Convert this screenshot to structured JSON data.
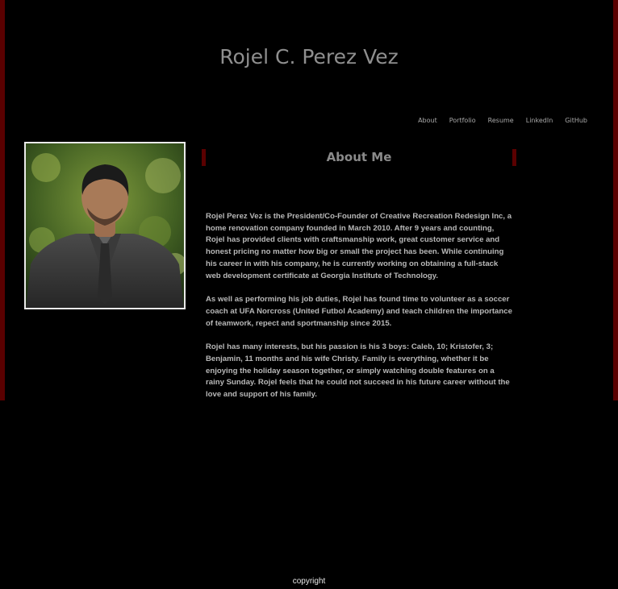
{
  "header": {
    "title": "Rojel C. Perez Vez"
  },
  "nav": {
    "items": [
      {
        "label": "About"
      },
      {
        "label": "Portfolio"
      },
      {
        "label": "Resume"
      },
      {
        "label": "LinkedIn"
      },
      {
        "label": "GitHub"
      }
    ]
  },
  "about": {
    "heading": "About Me",
    "paragraphs": [
      "Rojel Perez Vez is the President/Co-Founder of Creative Recreation Redesign Inc, a home renovation company founded in March 2010. After 9 years and counting, Rojel has provided clients with craftsmanship work, great customer service and honest pricing no matter how big or small the project has been. While continuing his career in with his company, he is currently working on obtaining a full-stack web development certificate at Georgia Institute of Technology.",
      "As well as performing his job duties, Rojel has found time to volunteer as a soccer coach at UFA Norcross (United Futbol Academy) and teach children the importance of teamwork, repect and sportmanship since 2015.",
      "Rojel has many interests, but his passion is his 3 boys: Caleb, 10; Kristofer, 3; Benjamin, 11 months and his wife Christy. Family is everything, whether it be enjoying the holiday season together, or simply watching double features on a rainy Sunday. Rojel feels that he could not succeed in his future career without the love and support of his family."
    ]
  },
  "footer": {
    "text": "copyright"
  },
  "colors": {
    "background": "#000000",
    "accent": "#5a0000",
    "title": "#8f8f8f"
  }
}
